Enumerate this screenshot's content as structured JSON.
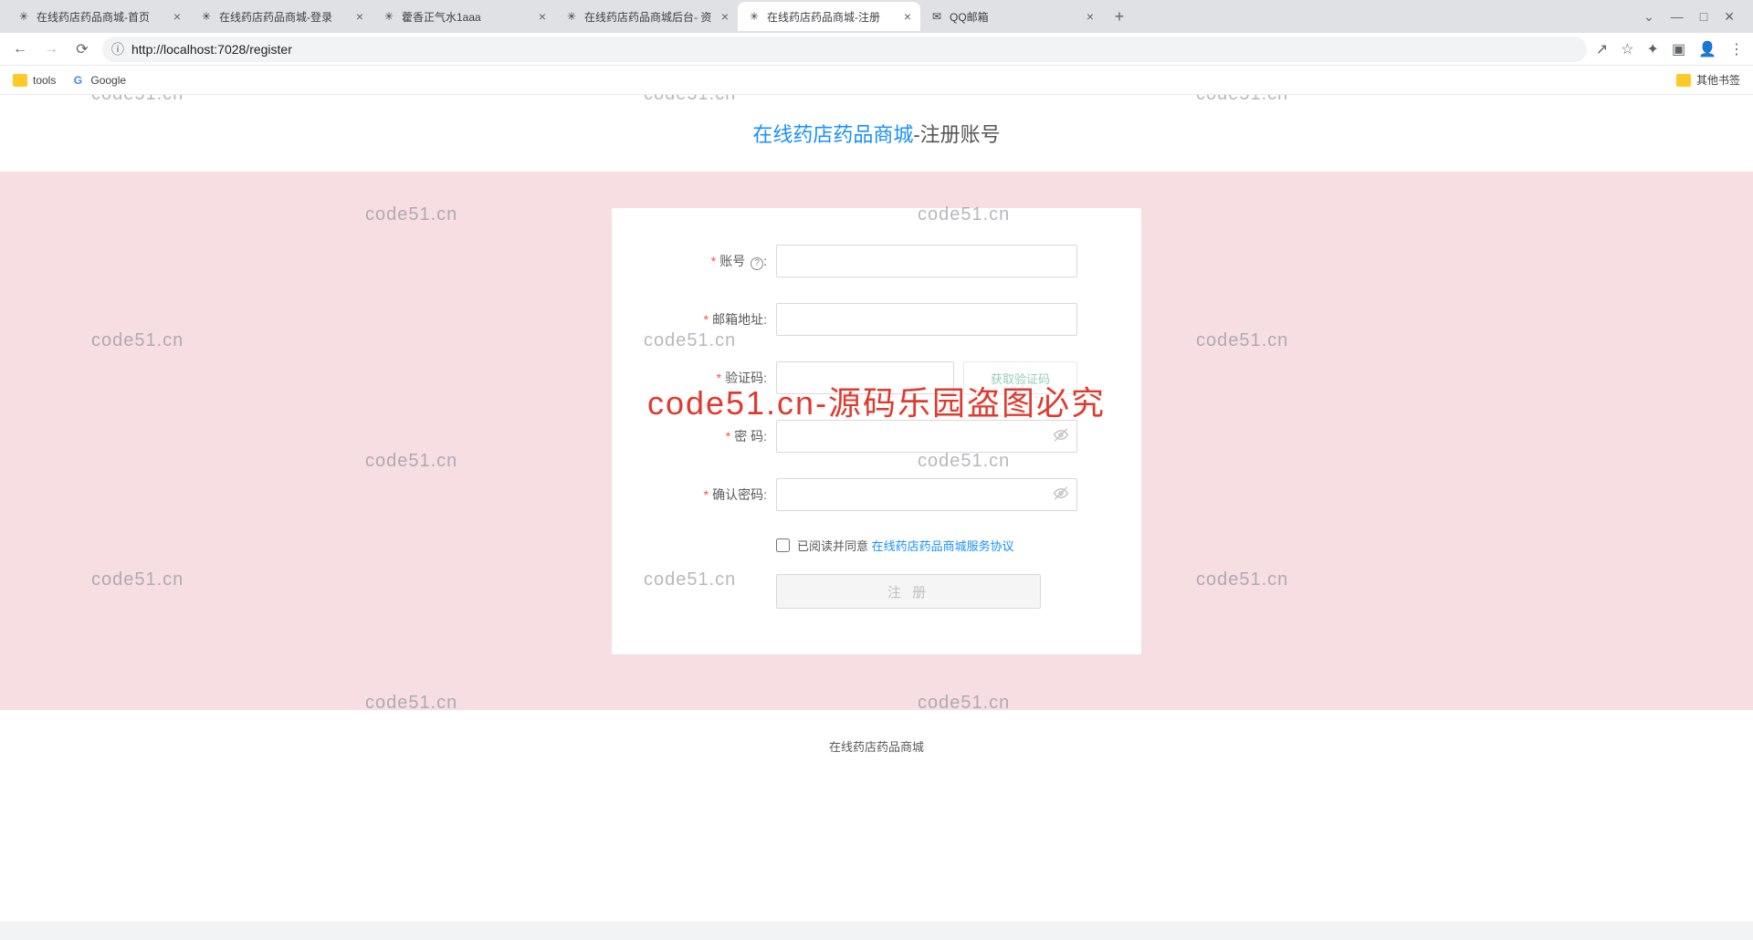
{
  "browser": {
    "tabs": [
      {
        "title": "在线药店药品商城-首页"
      },
      {
        "title": "在线药店药品商城-登录"
      },
      {
        "title": "藿香正气水1aaa"
      },
      {
        "title": "在线药店药品商城后台- 资"
      },
      {
        "title": "在线药店药品商城-注册"
      },
      {
        "title": "QQ邮箱"
      }
    ],
    "url": "http://localhost:7028/register",
    "bookmarks": {
      "tools": "tools",
      "google": "Google",
      "other": "其他书签"
    }
  },
  "page": {
    "title_link": "在线药店药品商城",
    "title_suffix": "-注册账号",
    "labels": {
      "account": "账号",
      "email": "邮箱地址:",
      "code": "验证码:",
      "password": "密 码:",
      "confirm": "确认密码:"
    },
    "code_btn": "获取验证码",
    "agree_prefix": "已阅读并同意",
    "agree_link": "在线药店药品商城服务协议",
    "submit": "注 册",
    "footer": "在线药店药品商城"
  },
  "watermark": {
    "small": "code51.cn",
    "big": "code51.cn-源码乐园盗图必究"
  }
}
